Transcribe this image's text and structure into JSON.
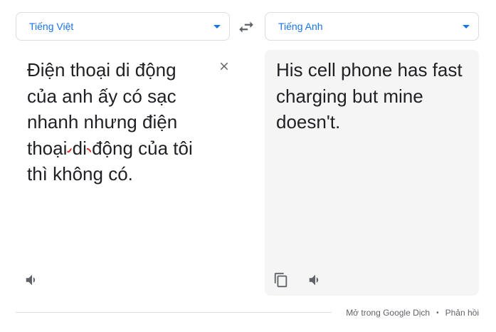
{
  "source_language": {
    "label": "Tiếng Việt",
    "dropdown_icon": "caret-down-icon"
  },
  "swap_icon": "swap-languages-icon",
  "target_language": {
    "label": "Tiếng Anh",
    "dropdown_icon": "caret-down-icon"
  },
  "source": {
    "text_before": "Điện thoại di động của anh ấy có sạc nhanh nhưng ",
    "text_misspelled": "điện thoại di động",
    "text_after": " của tôi thì không có.",
    "clear_icon": "close-icon",
    "listen_icon": "speaker-icon"
  },
  "target": {
    "text": "His cell phone has fast charging but mine doesn't.",
    "copy_icon": "copy-icon",
    "listen_icon": "speaker-icon"
  },
  "footer": {
    "open_in_translate": "Mở trong Google Dịch",
    "separator": "•",
    "feedback": "Phản hồi"
  },
  "colors": {
    "accent": "#1a73e8",
    "spell_error": "#d93025",
    "icon": "#5f6368",
    "text": "#202124"
  }
}
